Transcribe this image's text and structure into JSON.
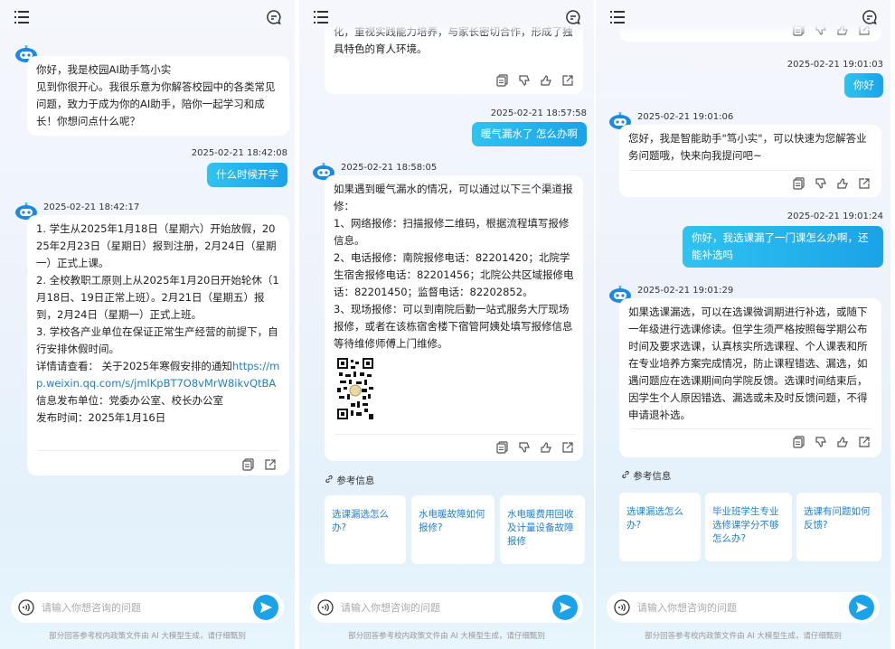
{
  "p1": {
    "greeting": [
      "你好，我是校园AI助手笃小实",
      "见到你很开心。我很乐意为你解答校园中的各类常见问题，致力于成为你的AI助手，陪你一起学习和成长！你想问点什么呢？"
    ],
    "user_ts": "2025-02-21 18:42:08",
    "user_msg": "什么时候开学",
    "bot_ts": "2025-02-21 18:42:17",
    "answer": [
      "1. 学生从2025年1月18日（星期六）开始放假，2025年2月23日（星期日）报到注册，2月24日（星期一）正式上课。",
      "2. 全校教职工原则上从2025年1月20日开始轮休（1月18日、19日正常上班）。2月21日（星期五）报到，2月24日（星期一）正式上班。",
      "3. 学校各产业单位在保证正常生产经营的前提下，自行安排休假时间。"
    ],
    "detail_prefix": "详情请查看：  关于2025年寒假安排的通知",
    "detail_link": "https://mp.weixin.qq.com/s/jmlKpBT7O8vMrW8ikvQtBA",
    "publisher": "信息发布单位：党委办公室、校长办公室",
    "pub_time": "发布时间：2025年1月16日"
  },
  "p2": {
    "prev_tail": "化，重视实践能力培养，与家长密切合作，形成了独具特色的育人环境。",
    "user_ts": "2025-02-21 18:57:58",
    "user_msg": "暖气漏水了 怎么办啊",
    "bot_ts": "2025-02-21 18:58:05",
    "answer": [
      "如果遇到暖气漏水的情况，可以通过以下三个渠道报修：",
      "1、网络报修：扫描报修二维码，根据流程填写报修信息。",
      "2、电话报修：南院报修电话：82201420；北院学生宿舍报修电话：82201456；北院公共区域报修电话：82201450；监督电话：82202852。",
      "3、现场报修：可以到南院后勤一站式服务大厅现场报修，或者在该栋宿舍楼下宿管阿姨处填写报修信息等待维修师傅上门维修。"
    ],
    "ref_title": "参考信息",
    "refs": [
      "选课漏选怎么办?",
      "水电暖故障如何报修?",
      "水电暖费用回收及计量设备故障报修"
    ]
  },
  "p3": {
    "user_ts1": "2025-02-21 19:01:03",
    "user_msg1": "你好",
    "bot_ts1": "2025-02-21 19:01:06",
    "answer1": "您好，我是智能助手\"笃小实\"，可以快速为您解答业务问题哦，快来向我提问吧~",
    "user_ts2": "2025-02-21 19:01:24",
    "user_msg2": "你好，我选课漏了一门课怎么办啊，还能补选吗",
    "bot_ts2": "2025-02-21 19:01:29",
    "answer2": "如果选课漏选，可以在选课微调期进行补选，或随下一年级进行选课修读。但学生须严格按照每学期公布时间及要求选课，认真核实所选课程、个人课表和所在专业培养方案完成情况，防止课程错选、漏选，如遇问题应在选课期间向学院反馈。选课时间结束后，因学生个人原因错选、漏选或未及时反馈问题，不得申请退补选。",
    "ref_title": "参考信息",
    "refs": [
      "选课漏选怎么办?",
      "毕业班学生专业选修课学分不够怎么办?",
      "选课有问题如何反馈?"
    ]
  },
  "input_placeholder": "请输入你想咨询的问题",
  "footnote": "部分回答参考校内政策文件由 AI 大模型生成，请仔细甄别",
  "colors": {
    "accent": "#1aa3e8",
    "link": "#1c7fd1"
  }
}
